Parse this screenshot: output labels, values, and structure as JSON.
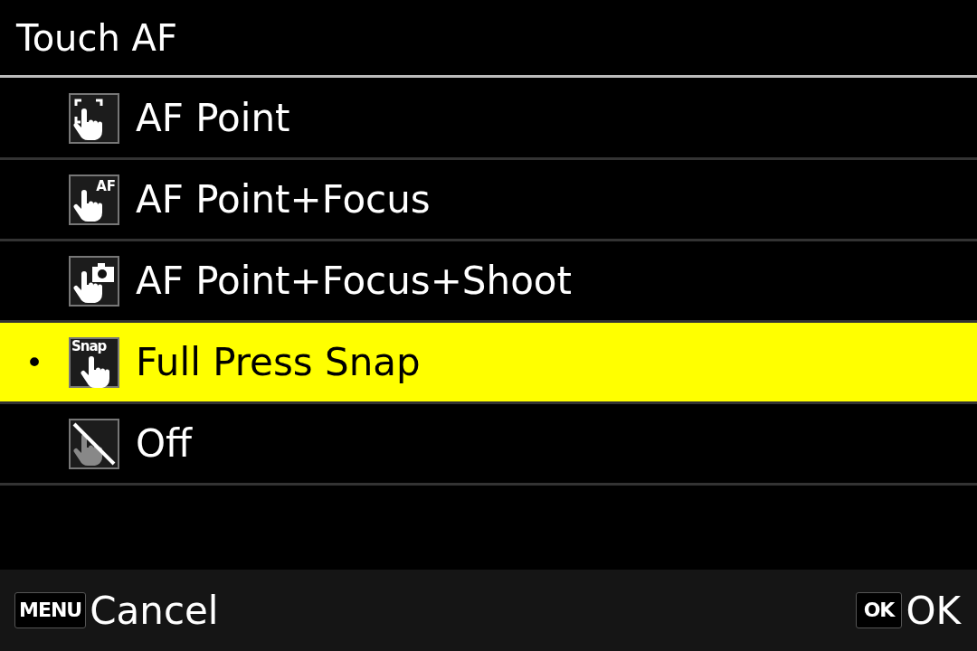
{
  "title": "Touch AF",
  "items": [
    {
      "label": "AF Point",
      "kind": "point",
      "selected": false
    },
    {
      "label": "AF Point+Focus",
      "kind": "focus",
      "icon_text": "AF",
      "selected": false
    },
    {
      "label": "AF Point+Focus+Shoot",
      "kind": "shoot",
      "selected": false
    },
    {
      "label": "Full Press Snap",
      "kind": "snap",
      "icon_text": "Snap",
      "selected": true,
      "bullet": "•"
    },
    {
      "label": "Off",
      "kind": "off",
      "selected": false
    }
  ],
  "footer": {
    "left": {
      "key": "MENU",
      "label": "Cancel"
    },
    "right": {
      "key": "OK",
      "label": "OK"
    }
  }
}
